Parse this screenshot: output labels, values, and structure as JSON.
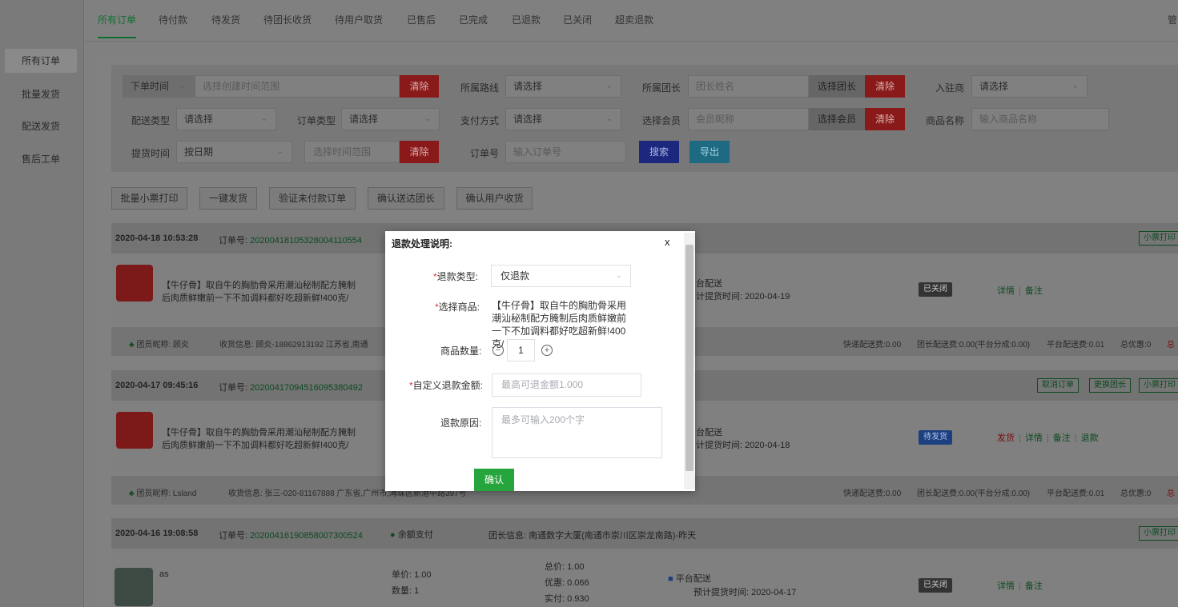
{
  "tabs": [
    "所有订单",
    "待付款",
    "待发货",
    "待团长收货",
    "待用户取货",
    "已售后",
    "已完成",
    "已退款",
    "已关闭",
    "超卖退款"
  ],
  "top_right": "管",
  "sidebar": [
    "所有订单",
    "批量发货",
    "配送发货",
    "售后工单"
  ],
  "filter": {
    "order_time_dropdown": "下单时间",
    "order_time_placeholder": "选择创建时间范围",
    "clear": "清除",
    "route_label": "所属路线",
    "please_select": "请选择",
    "leader_label": "所属团长",
    "leader_placeholder": "团长姓名",
    "select_leader": "选择团长",
    "merchant_label": "入驻商",
    "delivery_type_label": "配送类型",
    "order_type_label": "订单类型",
    "pay_method_label": "支付方式",
    "member_label": "选择会员",
    "member_placeholder": "会员昵称",
    "select_member": "选择会员",
    "product_label": "商品名称",
    "product_placeholder": "输入商品名称",
    "pickup_label": "提货时间",
    "by_date": "按日期",
    "time_range_placeholder": "选择时间范围",
    "order_no_label": "订单号",
    "order_no_placeholder": "输入订单号",
    "search": "搜索",
    "export": "导出"
  },
  "batch_buttons": [
    "批量小票打印",
    "一键发货",
    "验证未付款订单",
    "确认送达团长",
    "确认用户收货"
  ],
  "common": {
    "order_no_prefix": "订单号:",
    "print": "小票打印",
    "cancel_order": "取消订单",
    "change_leader": "更换团长",
    "detail": "详情",
    "remark": "备注",
    "ship": "发货",
    "refund": "退款",
    "pickup_prefix": "计提货时间: ",
    "platform_delivery": "台配送",
    "express_fee": "快递配送费:0.00",
    "leader_fee": "团长配送费:0.00(平台分成:0.00)",
    "platform_fee": "平台配送费:0.01",
    "total_discount": "总优惠:0",
    "total_short": "总"
  },
  "orders": [
    {
      "time": "2020-04-18 10:53:28",
      "no": "20200418105328004110554",
      "product_text": "【牛仔骨】取自牛的胸肋骨采用潮汕秘制配方腌制后肉质鲜嫩前一下不加调料都好吃超新鲜!400克/",
      "pickup": "2020-04-19",
      "status": "已关闭",
      "member": "团员昵称: 顾炎",
      "recv": "收货信息: 顾炎-18862913192  江苏省,南通"
    },
    {
      "time": "2020-04-17 09:45:16",
      "no": "20200417094516095380492",
      "product_text": "【牛仔骨】取自牛的胸肋骨采用潮汕秘制配方腌制后肉质鲜嫩前一下不加调料都好吃超新鲜!400克/",
      "pickup": "2020-04-18",
      "status": "待发货",
      "member": "团员昵称: Lsland",
      "recv": "收货信息: 张三-020-81167888  广东省,广州市,海珠区新港中路397号"
    },
    {
      "time": "2020-04-16 19:08:58",
      "no": "20200416190858007300524",
      "pay": "余额支付",
      "leader_info": "团长信息: 南通数字大厦(南通市崇川区崇龙南路)-昨天",
      "product_name": "as",
      "unit_price": "单价: 1.00",
      "qty": "数量: 1",
      "total": "总价: 1.00",
      "discount": "优惠: 0.066",
      "paid": "实付: 0.930",
      "delivery": "平台配送",
      "pickup_text": "预计提货时间: 2020-04-17",
      "status": "已关闭"
    }
  ],
  "modal": {
    "title": "退款处理说明:",
    "close": "x",
    "refund_type_label": "退款类型:",
    "refund_type_value": "仅退款",
    "product_label": "选择商品:",
    "product_text": "【牛仔骨】取自牛的胸肋骨采用潮汕秘制配方腌制后肉质鲜嫩前一下不加调料都好吃超新鲜!400克/",
    "qty_label": "商品数量:",
    "qty_value": "1",
    "amount_label": "自定义退款金额:",
    "amount_placeholder": "最高可退金额1.000",
    "reason_label": "退款原因:",
    "reason_placeholder": "最多可输入200个字",
    "confirm": "确认"
  }
}
